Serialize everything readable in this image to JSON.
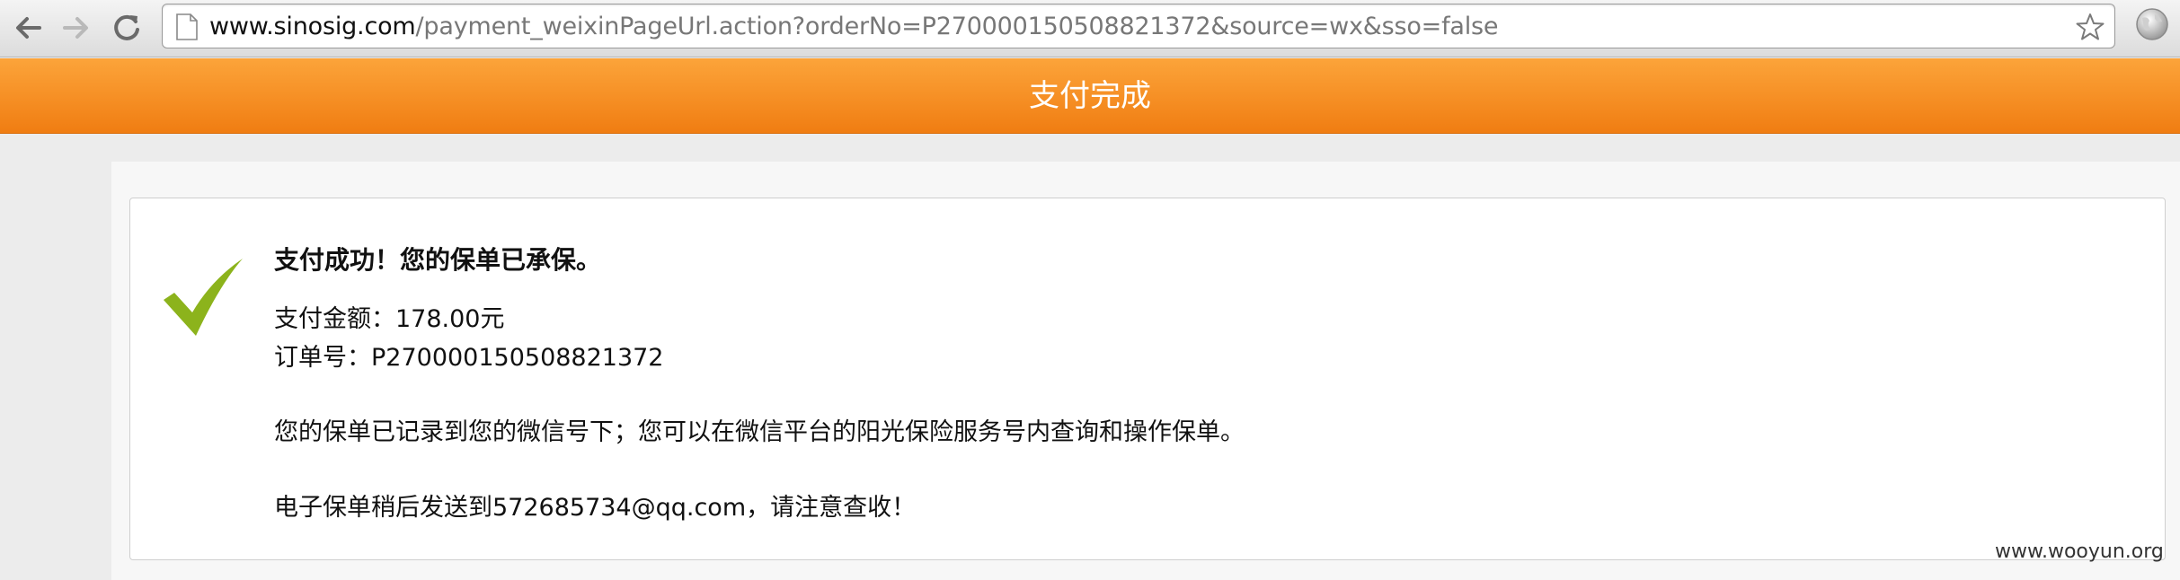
{
  "browser": {
    "url_host": "www.sinosig.com",
    "url_path": "/payment_weixinPageUrl.action?orderNo=P270000150508821372&source=wx&sso=false"
  },
  "header": {
    "title": "支付完成"
  },
  "result": {
    "title": "支付成功！您的保单已承保。",
    "amount_line": "支付金额：178.00元",
    "order_line": "订单号：P270000150508821372",
    "wechat_line": "您的保单已记录到您的微信号下；您可以在微信平台的阳光保险服务号内查询和操作保单。",
    "email_line": "电子保单稍后发送到572685734@qq.com，请注意查收！"
  },
  "watermark": "www.wooyun.org",
  "colors": {
    "header_orange_top": "#fca43a",
    "header_orange_bottom": "#f07d12",
    "check_green": "#8cb31c"
  },
  "icons": [
    "back-arrow-icon",
    "forward-arrow-icon",
    "reload-icon",
    "page-icon",
    "star-icon",
    "globe-icon",
    "checkmark-icon"
  ]
}
